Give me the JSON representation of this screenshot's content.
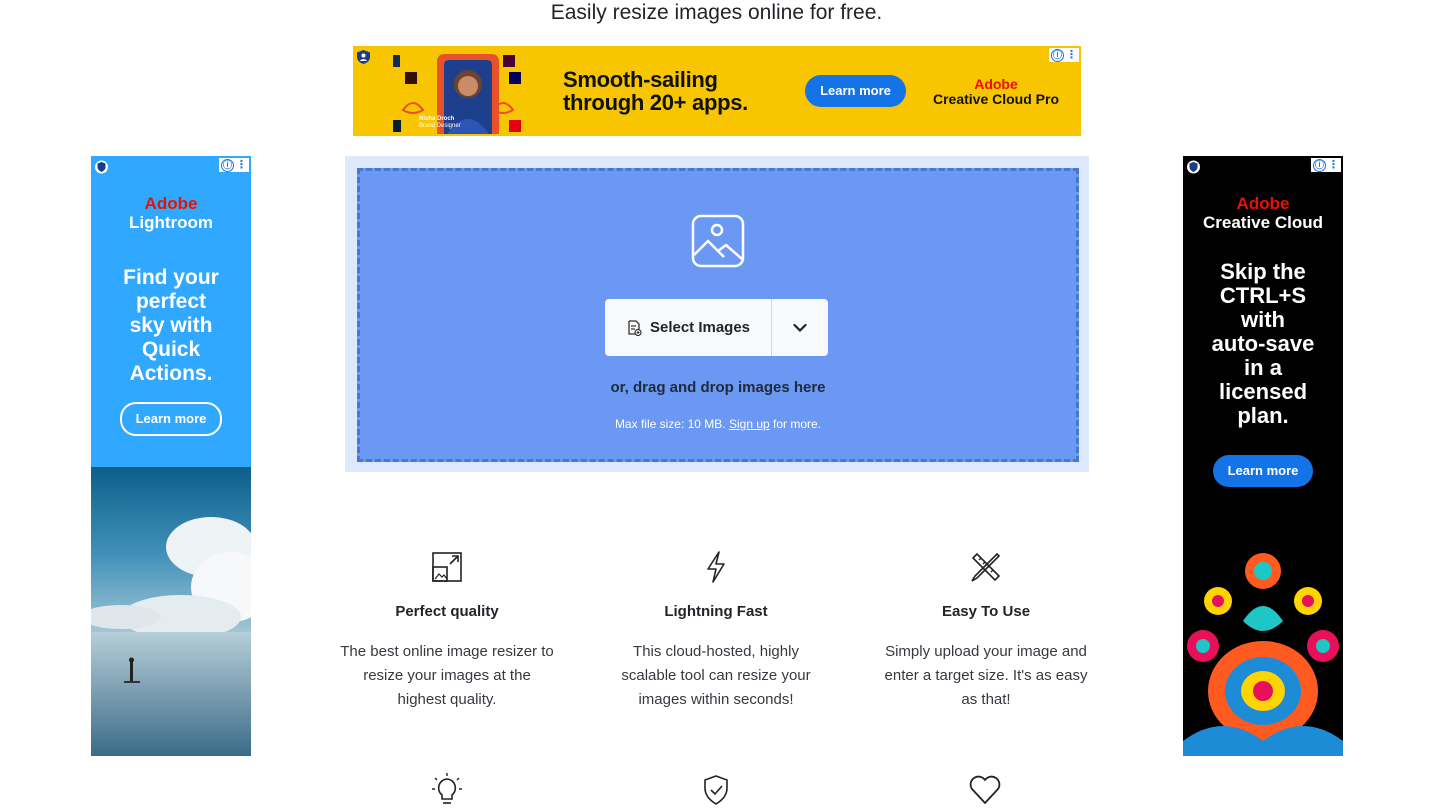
{
  "page": {
    "subtitle": "Easily resize images online for free."
  },
  "ads": {
    "top_banner": {
      "headline_line1": "Smooth-sailing",
      "headline_line2": "through 20+ apps.",
      "button": "Learn more",
      "brand_top": "Adobe",
      "brand_bottom": "Creative Cloud Pro",
      "person_name": "Nisha Droch",
      "person_title": "Brand Designer"
    },
    "left": {
      "brand_top": "Adobe",
      "brand_bottom": "Lightroom",
      "headline": [
        "Find your",
        "perfect",
        "sky with",
        "Quick",
        "Actions."
      ],
      "button": "Learn more"
    },
    "right": {
      "brand_top": "Adobe",
      "brand_bottom": "Creative Cloud",
      "headline": [
        "Skip the",
        "CTRL+S",
        "with",
        "auto-save",
        "in a",
        "licensed",
        "plan."
      ],
      "button": "Learn more"
    },
    "info_icon": "ⓘ",
    "kebab_icon": "⋮"
  },
  "upload": {
    "select_label": "Select Images",
    "drop_text": "or, drag and drop images here",
    "limit_prefix": "Max file size: 10 MB.",
    "signup_link": "Sign up",
    "limit_suffix": "for more."
  },
  "features": [
    {
      "icon": "resize-icon",
      "title": "Perfect quality",
      "text": "The best online image resizer to resize your images at the highest quality."
    },
    {
      "icon": "lightning-icon",
      "title": "Lightning Fast",
      "text": "This cloud-hosted, highly scalable tool can resize your images within seconds!"
    },
    {
      "icon": "pencil-ruler-icon",
      "title": "Easy To Use",
      "text": "Simply upload your image and enter a target size. It's as easy as that!"
    }
  ],
  "bottom_icons": [
    "lightbulb-icon",
    "shield-check-icon",
    "heart-icon"
  ]
}
